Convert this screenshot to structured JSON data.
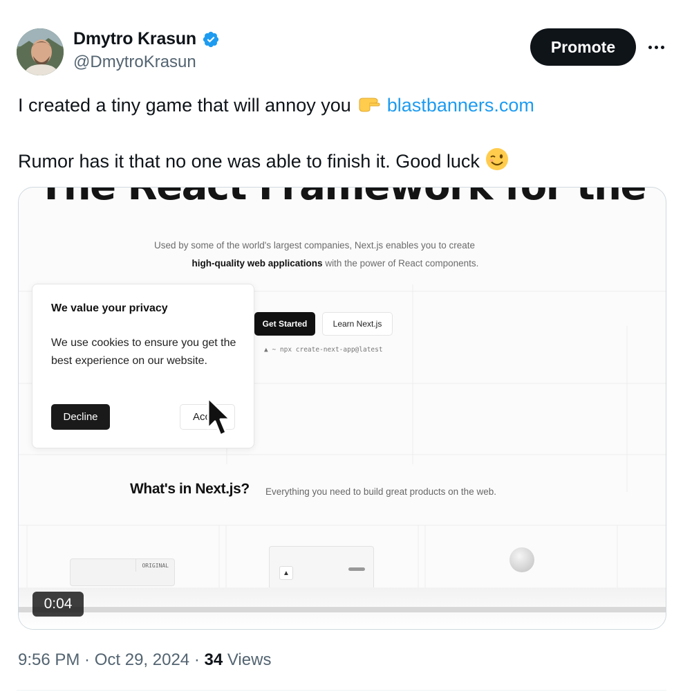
{
  "author": {
    "name": "Dmytro Krasun",
    "handle": "@DmytroKrasun",
    "verified_icon": "verified-badge-icon",
    "accent": "#1d9bf0"
  },
  "actions": {
    "promote_label": "Promote",
    "more_icon": "more-horizontal-icon"
  },
  "tweet": {
    "line1_text": "I created a tiny game that will annoy you",
    "line1_emoji": "👉",
    "link_text": "blastbanners.com",
    "line2_text": "Rumor has it that no one was able to finish it. Good luck",
    "line2_emoji": "😉"
  },
  "media": {
    "hero_title": "The React Framework for the Web",
    "subtitle_line1": "Used by some of the world's largest companies, Next.js enables you to create",
    "subtitle_line2_bold": "high-quality web applications",
    "subtitle_line2_rest": " with the power of React components.",
    "get_started_label": "Get Started",
    "learn_label": "Learn Next.js",
    "npx_command": "▲ ~ npx create-next-app@latest",
    "cookie": {
      "title": "We value your privacy",
      "text": "We use cookies to ensure you get the best experience on our website.",
      "decline_label": "Decline",
      "accept_label": "Accept"
    },
    "whats_title": "What's in Next.js?",
    "whats_subtitle": "Everything you need to build great products on the web.",
    "original_label": "ORIGINAL",
    "video_time": "0:04"
  },
  "footer": {
    "time": "9:56 PM",
    "sep1": " · ",
    "date": "Oct 29, 2024",
    "sep2": " · ",
    "views_count": "34",
    "views_label": " Views"
  }
}
